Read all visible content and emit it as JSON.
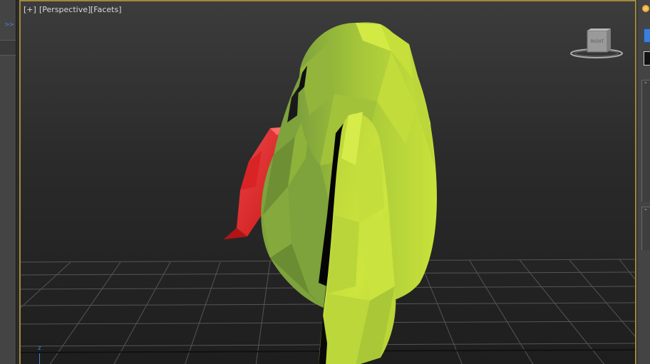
{
  "viewport": {
    "labels": {
      "plus": "[+]",
      "view": "[Perspective]",
      "shading": "[Facets]"
    },
    "viewcube_face": "RIGHT",
    "axis_label": "z"
  },
  "left_strip": {
    "expand_glyph": ">>"
  },
  "right_panel": {
    "rollout_minus_1": "-",
    "rollout_minus_2": "-"
  },
  "colors": {
    "viewport_border": "#a08a3a",
    "mesh_light": "#c9e23a",
    "mesh_mid": "#9cbd3a",
    "mesh_dark": "#6e8f34",
    "accent_red": "#e8282a",
    "axis_blue": "#4a7fd0"
  },
  "icons": {
    "viewcube": "viewcube-icon",
    "sun": "sun-icon"
  }
}
